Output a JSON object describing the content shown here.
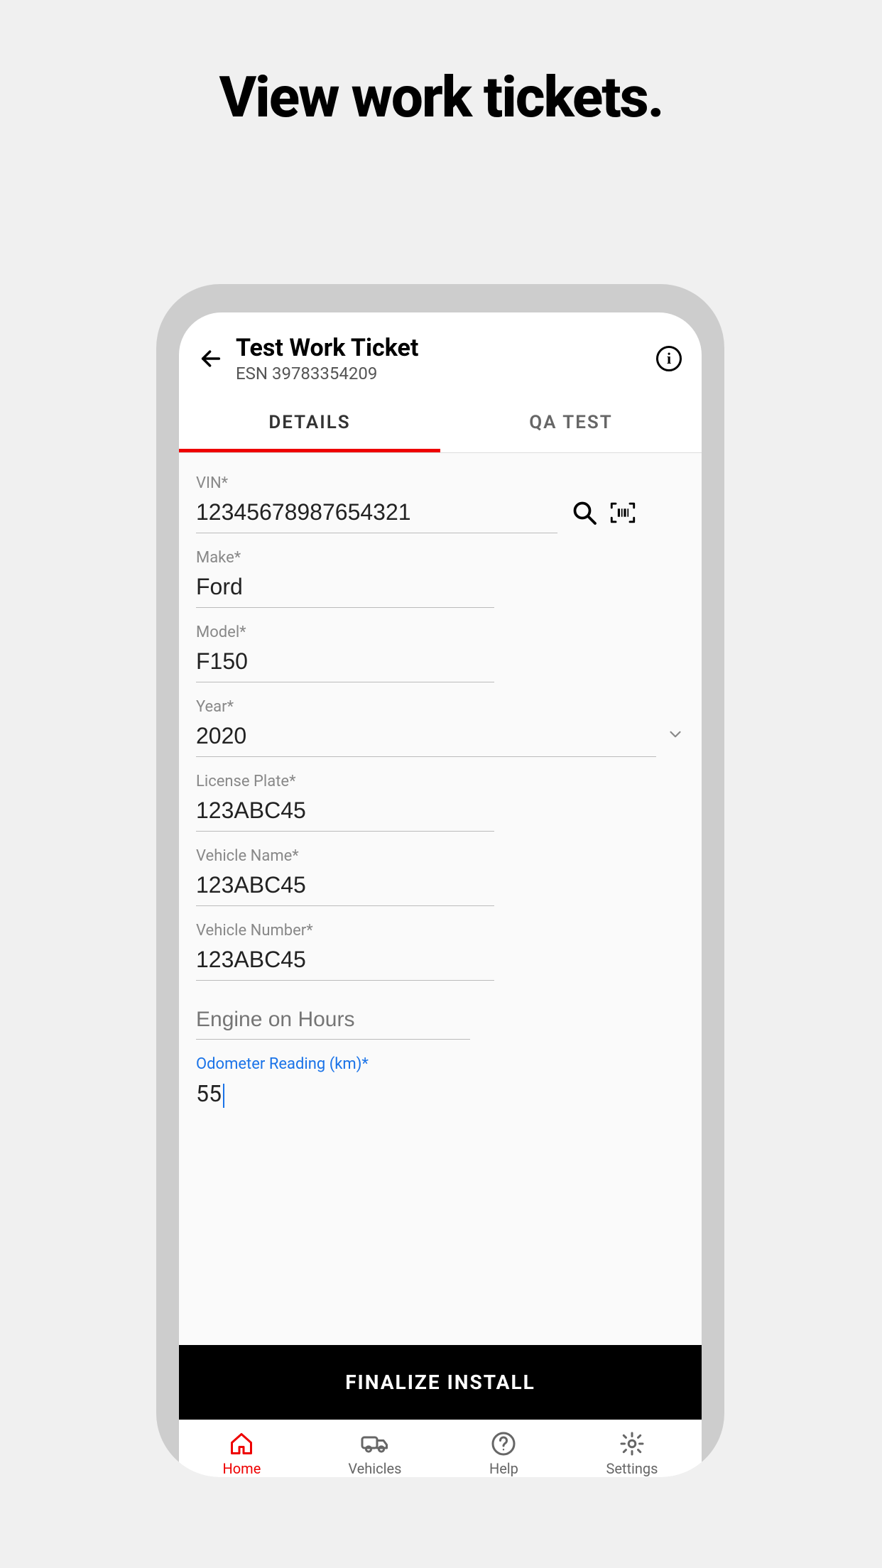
{
  "page": {
    "title": "View work tickets."
  },
  "header": {
    "title": "Test Work Ticket",
    "subtitle": "ESN 39783354209"
  },
  "tabs": {
    "details": "DETAILS",
    "qatest": "QA TEST"
  },
  "form": {
    "vin": {
      "label": "VIN*",
      "value": "12345678987654321"
    },
    "make": {
      "label": "Make*",
      "value": "Ford"
    },
    "model": {
      "label": "Model*",
      "value": "F150"
    },
    "year": {
      "label": "Year*",
      "value": "2020"
    },
    "license": {
      "label": "License Plate*",
      "value": "123ABC45"
    },
    "vehicle_name": {
      "label": "Vehicle Name*",
      "value": "123ABC45"
    },
    "vehicle_number": {
      "label": "Vehicle Number*",
      "value": "123ABC45"
    },
    "engine_hours": {
      "placeholder": "Engine on Hours"
    },
    "odometer": {
      "label": "Odometer Reading (km)*",
      "value": "55"
    }
  },
  "actions": {
    "finalize": "FINALIZE INSTALL"
  },
  "nav": {
    "home": "Home",
    "vehicles": "Vehicles",
    "help": "Help",
    "settings": "Settings"
  }
}
